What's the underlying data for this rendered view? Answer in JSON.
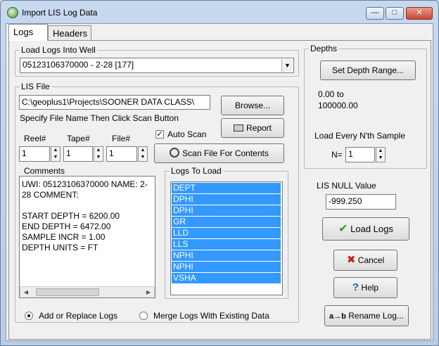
{
  "window": {
    "title": "Import LIS Log Data"
  },
  "tabs": [
    {
      "label": "Logs"
    },
    {
      "label": "Headers"
    }
  ],
  "load_into_well": {
    "label": "Load Logs Into Well",
    "selected": "05123106370000 - 2-28 [177]"
  },
  "depths": {
    "label": "Depths",
    "set_range_button": "Set Depth Range...",
    "range_start": "0.00 to",
    "range_end": "100000.00",
    "nth_label": "Load Every N'th Sample",
    "n_label": "N=",
    "n_value": "1"
  },
  "lis_file": {
    "label": "LIS File",
    "path": "C:\\geoplus1\\Projects\\SOONER DATA CLASS\\",
    "hint": "Specify File Name Then Click Scan Button",
    "browse_button": "Browse...",
    "report_button": "Report",
    "reel_label": "Reel#",
    "reel_value": "1",
    "tape_label": "Tape#",
    "tape_value": "1",
    "file_label": "File#",
    "file_value": "1",
    "auto_scan_label": "Auto Scan",
    "auto_scan_checked": true,
    "scan_button": "Scan File For Contents"
  },
  "comments": {
    "label": "Comments",
    "lines": [
      "UWI: 05123106370000  NAME: 2-",
      "28  COMMENT:",
      "",
      "START DEPTH = 6200.00",
      "END  DEPTH = 6472.00",
      "SAMPLE INCR = 1.00",
      "DEPTH UNITS = FT"
    ]
  },
  "logs_to_load": {
    "label": "Logs To Load",
    "items": [
      "DEPT",
      "DPHI",
      "DPHI",
      "GR",
      "LLD",
      "LLS",
      "NPHI",
      "NPHI",
      "VSHA"
    ]
  },
  "null_value": {
    "label": "LIS NULL Value",
    "value": "-999.250"
  },
  "buttons": {
    "load_logs": "Load Logs",
    "cancel": "Cancel",
    "help": "Help",
    "rename": "Rename Log..."
  },
  "merge_options": {
    "add_replace": "Add or Replace Logs",
    "merge": "Merge Logs With Existing Data",
    "selected": "add_replace"
  },
  "colors": {
    "selection": "#3399ff",
    "load_check": "#2a9d2a",
    "cancel_x": "#c0201c",
    "help_q": "#1a5fd0"
  }
}
